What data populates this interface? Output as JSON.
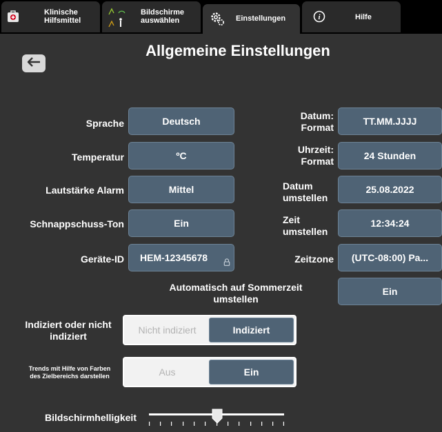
{
  "tabs": [
    {
      "label": "Klinische\nHilfsmittel",
      "icon": "first-aid-kit-icon"
    },
    {
      "label": "Bildschirme\nauswählen",
      "icon": "screen-select-icon"
    },
    {
      "label": "Einstellungen",
      "icon": "gears-icon",
      "active": true
    },
    {
      "label": "Hilfe",
      "icon": "info-icon"
    }
  ],
  "header": {
    "title": "Allgemeine Einstellungen",
    "back_icon": "back-arrow-icon"
  },
  "left_settings": [
    {
      "label": "Sprache",
      "value": "Deutsch"
    },
    {
      "label": "Temperatur",
      "value": "ºC"
    },
    {
      "label": "Lautstärke Alarm",
      "value": "Mittel"
    },
    {
      "label": "Schnappschuss-Ton",
      "value": "Ein"
    },
    {
      "label": "Geräte-ID",
      "value": "HEM-12345678",
      "locked": true
    }
  ],
  "right_settings": [
    {
      "label": "Datum:\nFormat",
      "value": "TT.MM.JJJJ"
    },
    {
      "label": "Uhrzeit:\nFormat",
      "value": "24 Stunden"
    },
    {
      "label": "Datum\numstellen",
      "value": "25.08.2022"
    },
    {
      "label": "Zeit\numstellen",
      "value": "12:34:24"
    },
    {
      "label": "Zeitzone",
      "value": "(UTC-08:00) Pa..."
    }
  ],
  "dst": {
    "label": "Automatisch auf Sommerzeit\numstellen",
    "value": "Ein"
  },
  "indexed": {
    "label": "Indiziert oder nicht\nindiziert",
    "options": [
      "Nicht indiziert",
      "Indiziert"
    ],
    "selected": "Indiziert"
  },
  "trend_colors": {
    "label": "Trends mit Hilfe von Farben\ndes Zielbereichs darstellen",
    "options": [
      "Aus",
      "Ein"
    ],
    "selected": "Ein"
  },
  "brightness": {
    "label": "Bildschirmhelligkeit",
    "level_fraction": 0.5
  },
  "colors": {
    "background": "#333333",
    "button": "#4f6375",
    "tabbar": "#000000"
  }
}
